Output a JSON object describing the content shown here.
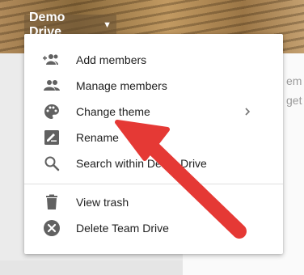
{
  "header": {
    "drive_name": "Demo Drive"
  },
  "background": {
    "text_line1": "em",
    "text_line2": "get"
  },
  "menu": {
    "items": [
      {
        "label": "Add members",
        "icon": "add-members-icon"
      },
      {
        "label": "Manage members",
        "icon": "people-icon"
      },
      {
        "label": "Change theme",
        "icon": "palette-icon",
        "has_submenu": true
      },
      {
        "label": "Rename",
        "icon": "rename-icon"
      },
      {
        "label": "Search within Demo Drive",
        "icon": "search-icon"
      },
      {
        "label": "View trash",
        "icon": "trash-icon"
      },
      {
        "label": "Delete Team Drive",
        "icon": "delete-circle-icon"
      }
    ]
  },
  "colors": {
    "icon": "#616161",
    "arrow": "#e53935",
    "menu_text": "#212121"
  }
}
